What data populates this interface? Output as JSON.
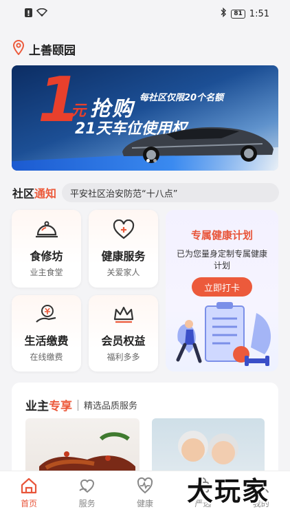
{
  "status_bar": {
    "time": "1:51",
    "battery": "81"
  },
  "location": {
    "name": "上善颐园"
  },
  "banner": {
    "digit": "1",
    "yuan": "元",
    "title": "抢购",
    "small": "每社区仅限20个名额",
    "subtitle": "21天车位使用权"
  },
  "notice": {
    "label_a": "社区",
    "label_b": "通知",
    "text": "平安社区治安防范“十八点”"
  },
  "services": [
    {
      "title": "食修坊",
      "sub": "业主食堂",
      "icon": "food-cloche-icon"
    },
    {
      "title": "健康服务",
      "sub": "关爱家人",
      "icon": "heart-plus-icon"
    },
    {
      "title": "生活缴费",
      "sub": "在线缴费",
      "icon": "yuan-hand-icon"
    },
    {
      "title": "会员权益",
      "sub": "福利多多",
      "icon": "crown-icon"
    }
  ],
  "health_plan": {
    "title": "专属健康计划",
    "desc": "已为您量身定制专属健康计划",
    "button": "立即打卡"
  },
  "exclusive": {
    "title_a": "业主",
    "title_b": "专享",
    "subtitle": "精选品质服务"
  },
  "tabbar": [
    {
      "label": "首页",
      "icon": "home-icon",
      "active": true
    },
    {
      "label": "服务",
      "icon": "service-icon",
      "active": false
    },
    {
      "label": "健康",
      "icon": "health-icon",
      "active": false
    },
    {
      "label": "严选",
      "icon": "select-icon",
      "active": false
    },
    {
      "label": "我的",
      "icon": "profile-icon",
      "active": false
    }
  ],
  "watermark": "大玩家",
  "colors": {
    "accent": "#ec5a3b",
    "background": "#f4f4f6"
  }
}
